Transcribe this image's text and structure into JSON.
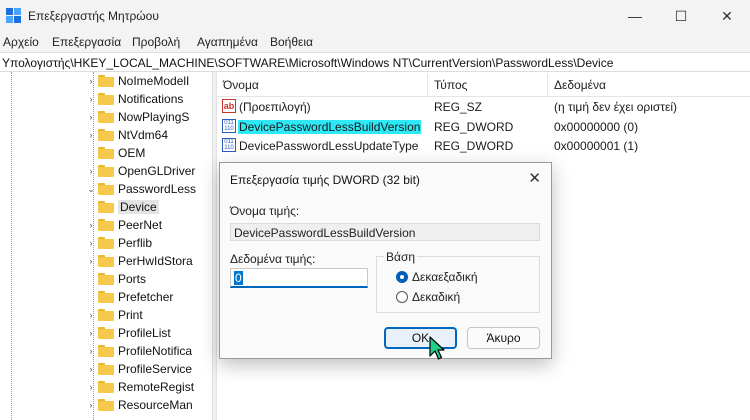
{
  "window": {
    "title": "Επεξεργαστής Μητρώου",
    "minimize": "—",
    "maximize": "☐",
    "close": "✕"
  },
  "menu": [
    "Αρχείο",
    "Επεξεργασία",
    "Προβολή",
    "Αγαπημένα",
    "Βοήθεια"
  ],
  "address": "Υπολογιστής\\HKEY_LOCAL_MACHINE\\SOFTWARE\\Microsoft\\Windows NT\\CurrentVersion\\PasswordLess\\Device",
  "tree": [
    {
      "label": "NoImeModelI",
      "chevron": "›"
    },
    {
      "label": "Notifications",
      "chevron": "›"
    },
    {
      "label": "NowPlayingS",
      "chevron": "›"
    },
    {
      "label": "NtVdm64",
      "chevron": "›"
    },
    {
      "label": "OEM",
      "chevron": ""
    },
    {
      "label": "OpenGLDriver",
      "chevron": "›"
    },
    {
      "label": "PasswordLess",
      "chevron": "⌄"
    },
    {
      "label": "Device",
      "chevron": "",
      "selected": true
    },
    {
      "label": "PeerNet",
      "chevron": "›"
    },
    {
      "label": "Perflib",
      "chevron": "›"
    },
    {
      "label": "PerHwIdStora",
      "chevron": "›"
    },
    {
      "label": "Ports",
      "chevron": ""
    },
    {
      "label": "Prefetcher",
      "chevron": ""
    },
    {
      "label": "Print",
      "chevron": "›"
    },
    {
      "label": "ProfileList",
      "chevron": "›"
    },
    {
      "label": "ProfileNotifica",
      "chevron": "›"
    },
    {
      "label": "ProfileService",
      "chevron": "›"
    },
    {
      "label": "RemoteRegist",
      "chevron": "›"
    },
    {
      "label": "ResourceMan",
      "chevron": "›"
    }
  ],
  "columns": {
    "name": "Όνομα",
    "type": "Τύπος",
    "data": "Δεδομένα"
  },
  "values": [
    {
      "icon": "string-value-icon",
      "icon_text": "ab",
      "name": "(Προεπιλογή)",
      "type": "REG_SZ",
      "data": "(η τιμή δεν έχει οριστεί)"
    },
    {
      "icon": "binary-value-icon",
      "icon_text": "011 110",
      "name": "DevicePasswordLessBuildVersion",
      "type": "REG_DWORD",
      "data": "0x00000000 (0)",
      "highlighted": true
    },
    {
      "icon": "binary-value-icon",
      "icon_text": "011 110",
      "name": "DevicePasswordLessUpdateType",
      "type": "REG_DWORD",
      "data": "0x00000001 (1)"
    }
  ],
  "dialog": {
    "title": "Επεξεργασία τιμής DWORD (32 bit)",
    "close": "✕",
    "name_label": "Όνομα τιμής:",
    "name_value": "DevicePasswordLessBuildVersion",
    "data_label": "Δεδομένα τιμής:",
    "data_value": "0",
    "base_label": "Βάση",
    "base_options": [
      {
        "label": "Δεκαεξαδική",
        "checked": true
      },
      {
        "label": "Δεκαδική",
        "checked": false
      }
    ],
    "ok_label": "OK",
    "cancel_label": "Άκυρο"
  },
  "colors": {
    "accent": "#0067c0",
    "highlight": "#2ee8f5",
    "folder": "#f6c84c"
  }
}
